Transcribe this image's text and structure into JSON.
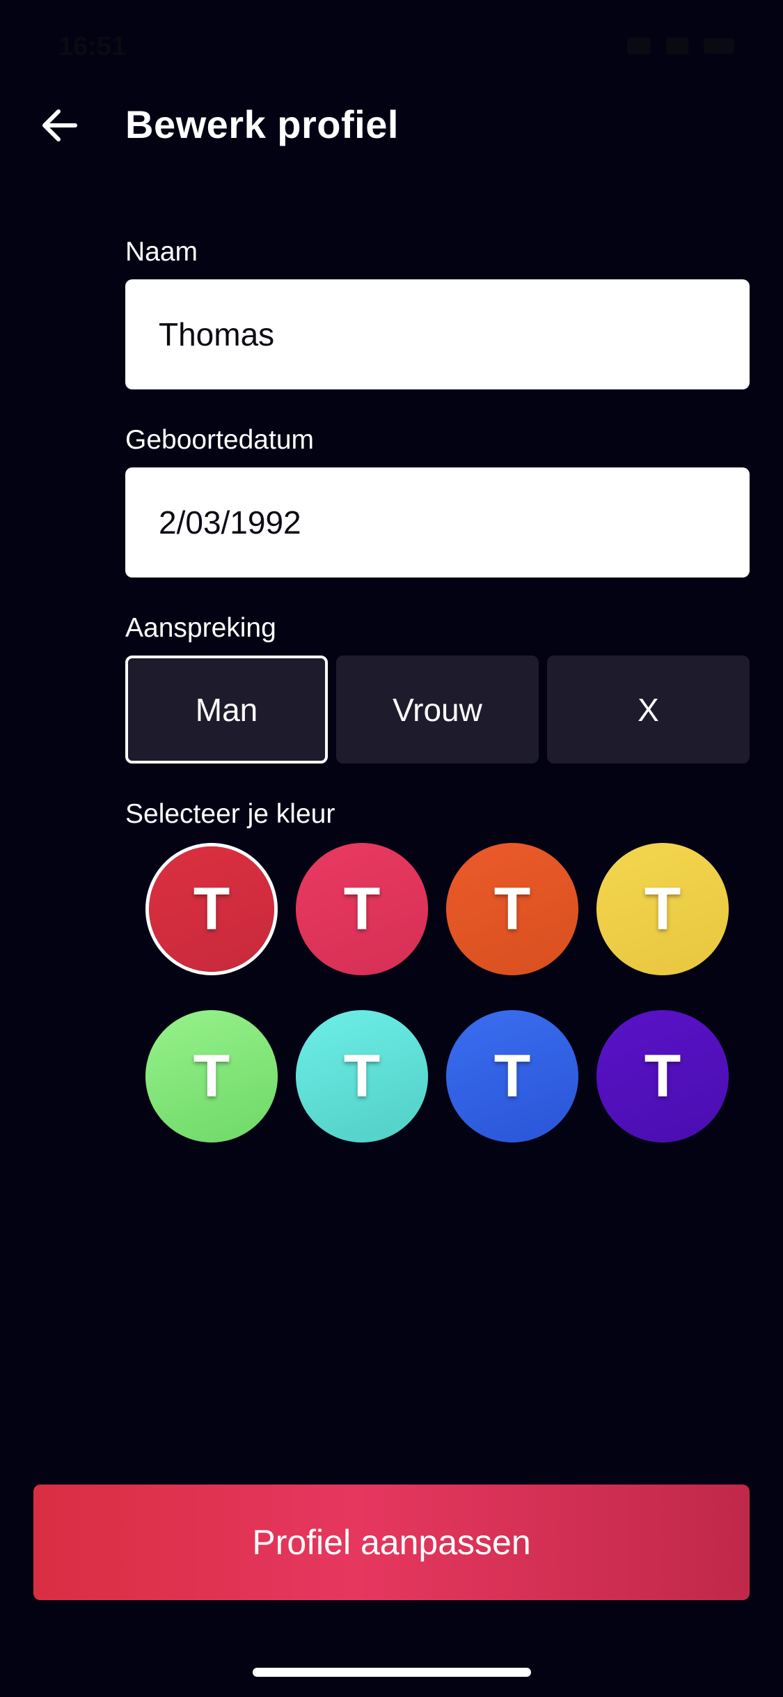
{
  "status_bar": {
    "time": "16:51",
    "icons": [
      "signal-icon",
      "wifi-icon",
      "battery-icon"
    ]
  },
  "header": {
    "back_icon": "arrow-left-icon",
    "title": "Bewerk profiel"
  },
  "form": {
    "name": {
      "label": "Naam",
      "value": "Thomas"
    },
    "birthdate": {
      "label": "Geboortedatum",
      "value": "2/03/1992"
    },
    "salutation": {
      "label": "Aanspreking",
      "options": [
        "Man",
        "Vrouw",
        "X"
      ],
      "selected": "Man"
    },
    "color": {
      "label": "Selecteer je kleur",
      "initial": "T",
      "selected_index": 0,
      "swatches": [
        {
          "color_from": "#dc3040",
          "color_to": "#c72a3c"
        },
        {
          "color_from": "#ea3a62",
          "color_to": "#d62f55"
        },
        {
          "color_from": "#ec5a2a",
          "color_to": "#d8501f"
        },
        {
          "color_from": "#f4d64e",
          "color_to": "#e8c640"
        },
        {
          "color_from": "#95f28a",
          "color_to": "#6fd868"
        },
        {
          "color_from": "#6ceee6",
          "color_to": "#52cfc6"
        },
        {
          "color_from": "#3a6ef0",
          "color_to": "#2a55d6"
        },
        {
          "color_from": "#5a12c8",
          "color_to": "#4a0eb0"
        }
      ]
    }
  },
  "actions": {
    "submit_label": "Profiel aanpassen"
  },
  "colors": {
    "background": "#030213",
    "field_bg": "#ffffff",
    "segment_bg": "#1e1c2c",
    "accent": "#e6375f"
  }
}
